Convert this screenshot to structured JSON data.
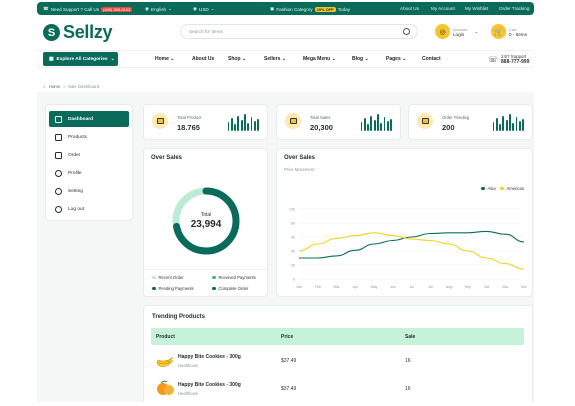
{
  "topbar": {
    "support_label": "Need Support ? Call Us",
    "phone": "(480) 555-0103",
    "language": "English",
    "currency": "USD",
    "promo_label": "Fashion Category",
    "promo_badge": "20% OFF",
    "promo_suffix": "Today",
    "links": [
      "About Us",
      "My Account",
      "My Wishlist",
      "Order Tracking"
    ]
  },
  "header": {
    "logo": "Sellzy",
    "search_placeholder": "Search for Items",
    "account_label": "Account",
    "account_action": "Login",
    "cart_label": "Cart",
    "cart_items": "0 - Items"
  },
  "nav": {
    "categories_button": "Explore All Categories",
    "items": [
      "Home",
      "About Us",
      "Shop",
      "Sellers",
      "Mega Menu",
      "Blog",
      "Pages",
      "Contact"
    ],
    "support_label": "24/7 Support",
    "support_phone": "888-777-999"
  },
  "breadcrumb": {
    "home": "Home",
    "current": "Sale Dashboard"
  },
  "sidebar": {
    "items": [
      {
        "label": "Dashboard",
        "icon": "grid-icon"
      },
      {
        "label": "Products",
        "icon": "box-icon"
      },
      {
        "label": "Order",
        "icon": "order-icon"
      },
      {
        "label": "Profile",
        "icon": "user-icon"
      },
      {
        "label": "Setting",
        "icon": "gear-icon"
      },
      {
        "label": "Log out",
        "icon": "logout-icon"
      }
    ]
  },
  "stats": [
    {
      "label": "Total Product",
      "value": "18.765"
    },
    {
      "label": "Total Sales",
      "value": "20,300"
    },
    {
      "label": "Order Pending",
      "value": "200"
    }
  ],
  "over_sales_donut": {
    "title": "Over Sales",
    "total_label": "Total",
    "total_value": "23,994",
    "legend": [
      "Recent Order",
      "Received Payments",
      "Pending Payments",
      "Complete Order"
    ],
    "colors": {
      "primary": "#0b6b5b",
      "light": "#bdebd6",
      "mid": "#3fb38f"
    }
  },
  "over_sales_chart": {
    "title": "Over Sales",
    "subtitle": "Price Movement"
  },
  "chart_data": {
    "type": "line",
    "x": [
      "Jan",
      "Feb",
      "Mar",
      "Apr",
      "May",
      "Jun",
      "Jul",
      "Jul",
      "Aug",
      "Sep",
      "Oct",
      "Nov",
      "Dec"
    ],
    "ylim": [
      0,
      100
    ],
    "yticks": [
      0,
      20,
      40,
      60,
      80,
      100
    ],
    "grid": true,
    "legend_position": "top-right",
    "series": [
      {
        "name": "Asia",
        "color": "#0b6b5b",
        "values": [
          30,
          30,
          33,
          41,
          50,
          55,
          60,
          65,
          66,
          66,
          68,
          64,
          53
        ]
      },
      {
        "name": "Americas",
        "color": "#f2d31b",
        "values": [
          40,
          50,
          58,
          62,
          66,
          62,
          57,
          55,
          50,
          40,
          30,
          22,
          14
        ]
      }
    ]
  },
  "trending": {
    "title": "Trending Products",
    "columns": [
      "Product",
      "Price",
      "Sale"
    ],
    "rows": [
      {
        "name": "Happy Bite Cookies - 300g",
        "category": "Healthcare",
        "price": "$37.49",
        "sale": "16"
      },
      {
        "name": "Happy Bite Cookies - 300g",
        "category": "Healthcare",
        "price": "$37.49",
        "sale": "16"
      }
    ]
  }
}
